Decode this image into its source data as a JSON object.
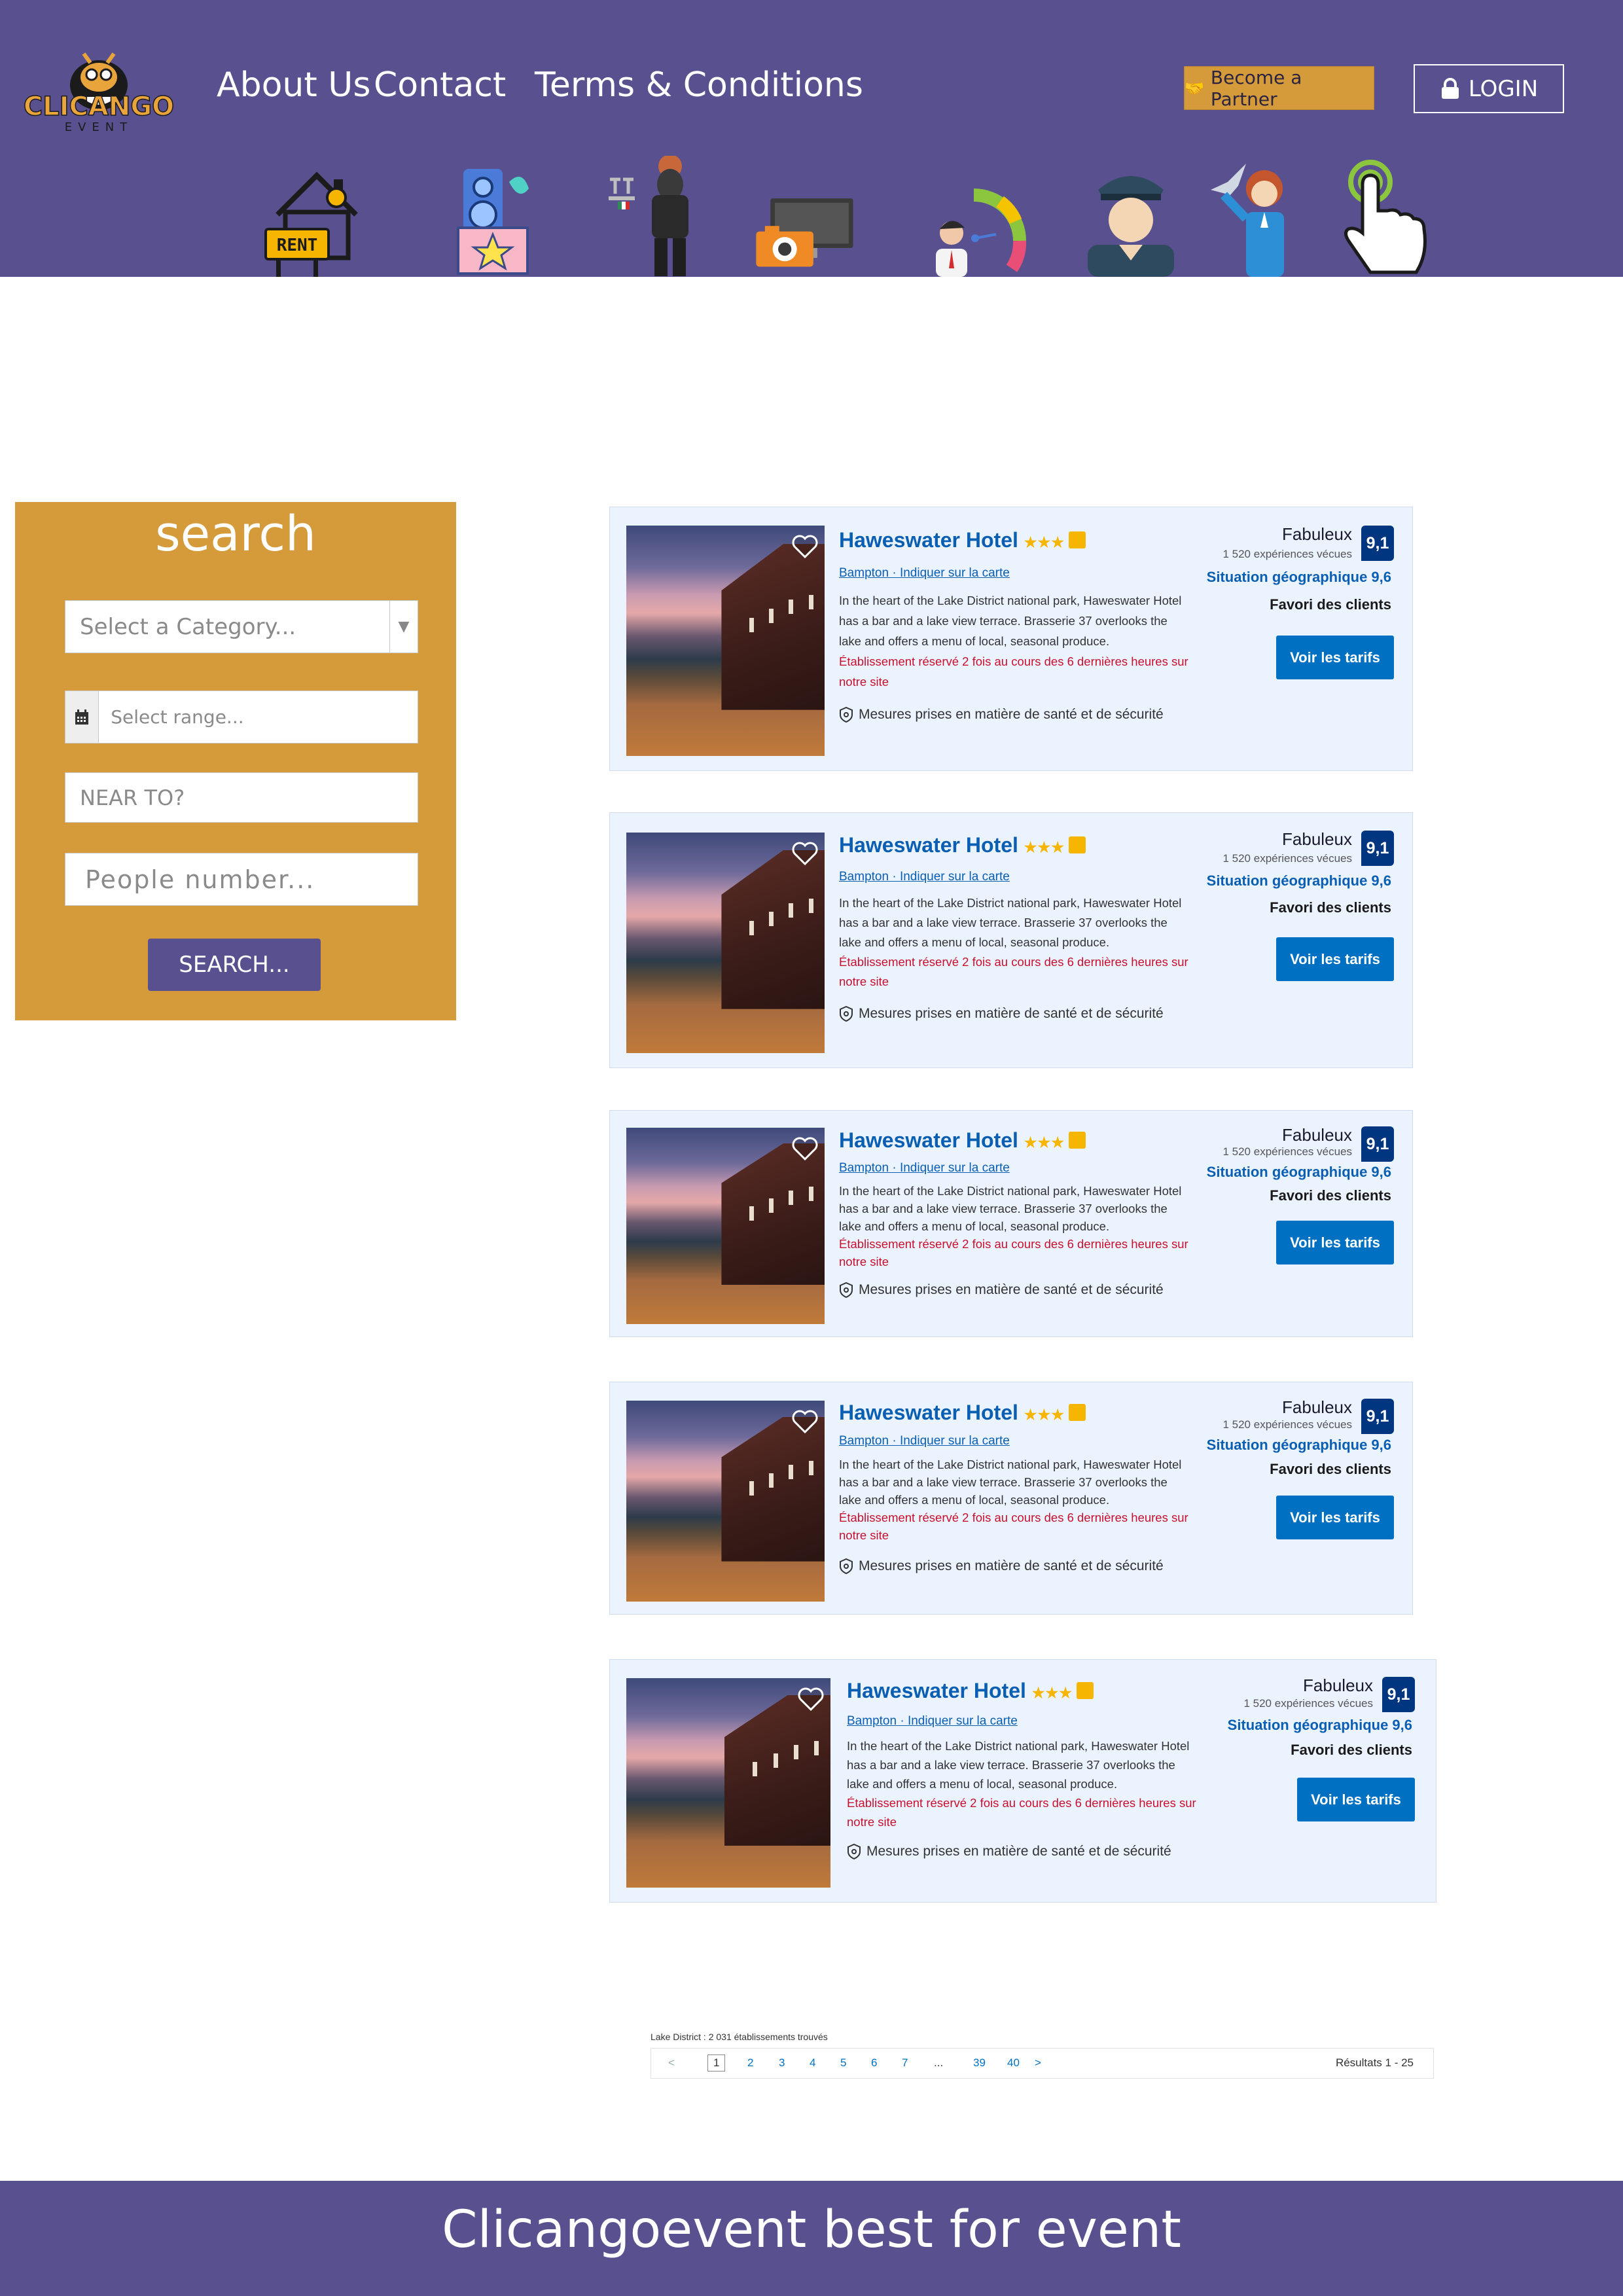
{
  "header": {
    "logo_text": "CLICANGO",
    "logo_sub": "EVENT",
    "nav": [
      "About Us",
      "Contact",
      "Terms & Conditions"
    ],
    "partner_label": "Become a Partner",
    "login_label": "LOGIN",
    "categories": [
      "rent-icon",
      "dj-music-icon",
      "waiter-icon",
      "photo-video-icon",
      "entertainment-icon",
      "security-icon",
      "hostess-icon",
      "click-icon"
    ],
    "rent_sign": "RENT"
  },
  "search": {
    "title": "search",
    "category_placeholder": "Select a Category...",
    "range_placeholder": "Select range...",
    "near_placeholder": "NEAR TO?",
    "people_placeholder": "People number...",
    "button_label": "SEARCH..."
  },
  "hotels": [
    {
      "name": "Haweswater Hotel",
      "stars": "★★★",
      "town": "Bampton",
      "map_link": "Indiquer sur la carte",
      "description": "In the heart of the Lake District national park, Haweswater Hotel has a bar and a lake view terrace. Brasserie 37 overlooks the lake and offers a menu of local, seasonal produce.",
      "booked_note": "Établissement réservé 2 fois au cours des 6 dernières heures sur notre site",
      "health": "Mesures prises en matière de santé et de sécurité",
      "rating_word": "Fabuleux",
      "reviews": "1 520 expériences vécues",
      "score": "9,1",
      "location_score": "Situation géographique 9,6",
      "favorite": "Favori des clients",
      "button": "Voir les tarifs"
    },
    {
      "name": "Haweswater Hotel",
      "stars": "★★★",
      "town": "Bampton",
      "map_link": "Indiquer sur la carte",
      "description": "In the heart of the Lake District national park, Haweswater Hotel has a bar and a lake view terrace. Brasserie 37 overlooks the lake and offers a menu of local, seasonal produce.",
      "booked_note": "Établissement réservé 2 fois au cours des 6 dernières heures sur notre site",
      "health": "Mesures prises en matière de santé et de sécurité",
      "rating_word": "Fabuleux",
      "reviews": "1 520 expériences vécues",
      "score": "9,1",
      "location_score": "Situation géographique 9,6",
      "favorite": "Favori des clients",
      "button": "Voir les tarifs"
    },
    {
      "name": "Haweswater Hotel",
      "stars": "★★★",
      "town": "Bampton",
      "map_link": "Indiquer sur la carte",
      "description": "In the heart of the Lake District national park, Haweswater Hotel has a bar and a lake view terrace. Brasserie 37 overlooks the lake and offers a menu of local, seasonal produce.",
      "booked_note": "Établissement réservé 2 fois au cours des 6 dernières heures sur notre site",
      "health": "Mesures prises en matière de santé et de sécurité",
      "rating_word": "Fabuleux",
      "reviews": "1 520 expériences vécues",
      "score": "9,1",
      "location_score": "Situation géographique 9,6",
      "favorite": "Favori des clients",
      "button": "Voir les tarifs"
    },
    {
      "name": "Haweswater Hotel",
      "stars": "★★★",
      "town": "Bampton",
      "map_link": "Indiquer sur la carte",
      "description": "In the heart of the Lake District national park, Haweswater Hotel has a bar and a lake view terrace. Brasserie 37 overlooks the lake and offers a menu of local, seasonal produce.",
      "booked_note": "Établissement réservé 2 fois au cours des 6 dernières heures sur notre site",
      "health": "Mesures prises en matière de santé et de sécurité",
      "rating_word": "Fabuleux",
      "reviews": "1 520 expériences vécues",
      "score": "9,1",
      "location_score": "Situation géographique 9,6",
      "favorite": "Favori des clients",
      "button": "Voir les tarifs"
    },
    {
      "name": "Haweswater Hotel",
      "stars": "★★★",
      "town": "Bampton",
      "map_link": "Indiquer sur la carte",
      "description": "In the heart of the Lake District national park, Haweswater Hotel has a bar and a lake view terrace. Brasserie 37 overlooks the lake and offers a menu of local, seasonal produce.",
      "booked_note": "Établissement réservé 2 fois au cours des 6 dernières heures sur notre site",
      "health": "Mesures prises en matière de santé et de sécurité",
      "rating_word": "Fabuleux",
      "reviews": "1 520 expériences vécues",
      "score": "9,1",
      "location_score": "Situation géographique 9,6",
      "favorite": "Favori des clients",
      "button": "Voir les tarifs"
    }
  ],
  "pagination": {
    "found_text": "Lake District : 2 031 établissements trouvés",
    "prev": "<",
    "pages": [
      "1",
      "2",
      "3",
      "4",
      "5",
      "6",
      "7",
      "...",
      "39",
      "40"
    ],
    "next": ">",
    "results": "Résultats 1 - 25"
  },
  "footer": {
    "text": "Clicangoevent best for event"
  },
  "colors": {
    "brand_purple": "#59518f",
    "brand_gold": "#d59b3a",
    "link_blue": "#0a5fb3",
    "button_blue": "#0071c2",
    "score_navy": "#003580",
    "alert_red": "#c8102e"
  }
}
